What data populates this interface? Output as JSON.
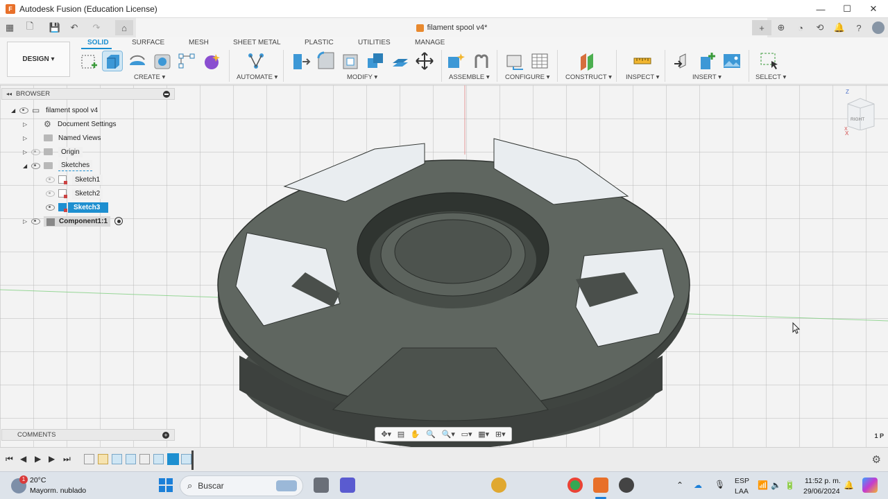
{
  "window": {
    "title": "Autodesk Fusion (Education License)",
    "document_tab": "filament spool v4*"
  },
  "ribbon": {
    "workspace": "DESIGN",
    "tabs": [
      "SOLID",
      "SURFACE",
      "MESH",
      "SHEET METAL",
      "PLASTIC",
      "UTILITIES",
      "MANAGE"
    ],
    "active_tab": "SOLID",
    "groups": [
      "CREATE",
      "AUTOMATE",
      "MODIFY",
      "ASSEMBLE",
      "CONFIGURE",
      "CONSTRUCT",
      "INSPECT",
      "INSERT",
      "SELECT"
    ],
    "dropdown_glyph": "▾"
  },
  "browser": {
    "header": "BROWSER",
    "root": "filament spool v4",
    "items": [
      {
        "label": "Document Settings",
        "icon": "gear-icon"
      },
      {
        "label": "Named Views",
        "icon": "folder-icon"
      },
      {
        "label": "Origin",
        "icon": "folder-icon"
      },
      {
        "label": "Sketches",
        "icon": "folder-icon"
      },
      {
        "label": "Sketch1",
        "icon": "sketch-icon"
      },
      {
        "label": "Sketch2",
        "icon": "sketch-icon"
      },
      {
        "label": "Sketch3",
        "icon": "sketch-icon",
        "selected": true
      },
      {
        "label": "Component1:1",
        "icon": "component-icon"
      }
    ]
  },
  "comments": {
    "label": "COMMENTS"
  },
  "viewcube": {
    "face": "RIGHT",
    "axis_z": "Z",
    "axis_x": "X"
  },
  "status": {
    "page_indicator": "1 P"
  },
  "taskbar": {
    "weather_temp": "20°C",
    "weather_desc": "Mayorm. nublado",
    "weather_badge": "1",
    "search_placeholder": "Buscar",
    "lang_line1": "ESP",
    "lang_line2": "LAA",
    "time": "11:52 p. m.",
    "date": "29/06/2024"
  },
  "colors": {
    "accent": "#1a8ed0",
    "model": "#5f6660",
    "selection": "#1e8fd0"
  }
}
